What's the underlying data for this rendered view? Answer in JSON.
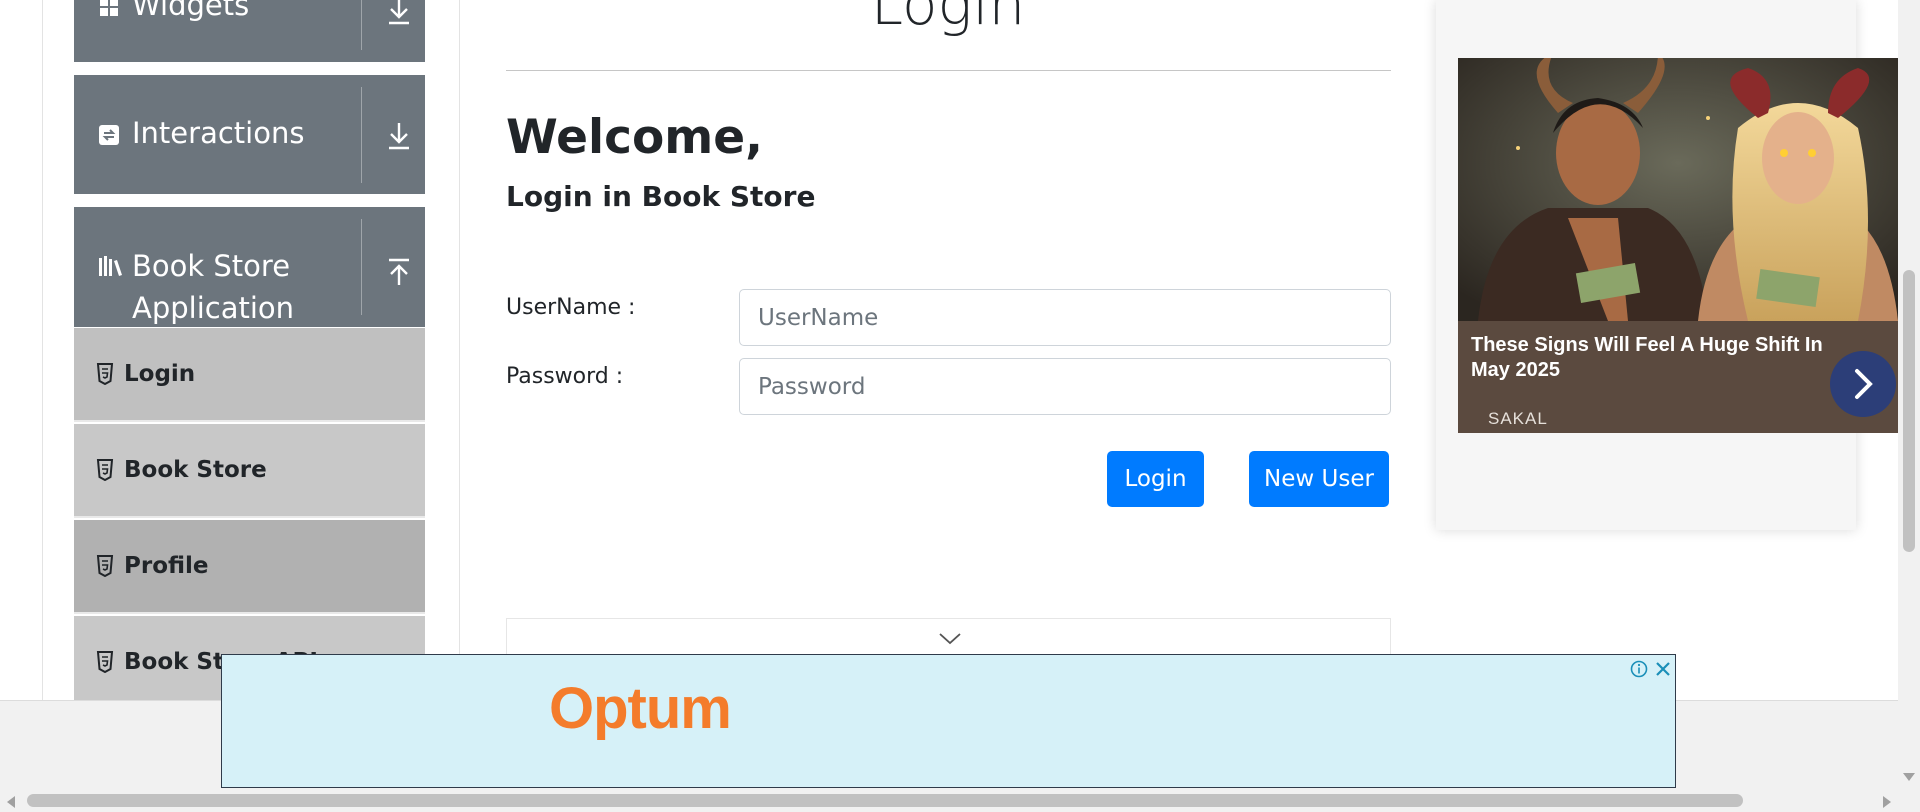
{
  "sidebar": {
    "groups": [
      {
        "label": "Widgets",
        "icon": "widgets-icon",
        "arrow": "arrow-down-icon"
      },
      {
        "label": "Interactions",
        "icon": "interactions-icon",
        "arrow": "arrow-down-icon"
      },
      {
        "label_line1": "Book Store",
        "label_line2": "Application",
        "icon": "books-icon",
        "arrow": "arrow-up-icon"
      }
    ],
    "items": [
      {
        "label": "Login",
        "bg": "#c0c0c0"
      },
      {
        "label": "Book Store",
        "bg": "#c8c8c8"
      },
      {
        "label": "Profile",
        "bg": "#b1b1b1"
      },
      {
        "label": "Book Store API",
        "bg": "#c8c8c8"
      }
    ]
  },
  "main": {
    "title": "Login",
    "welcome": "Welcome,",
    "subheading": "Login in Book Store",
    "username_label": "UserName :",
    "username_placeholder": "UserName",
    "password_label": "Password :",
    "password_placeholder": "Password",
    "login_button": "Login",
    "new_user_button": "New User"
  },
  "side_ad": {
    "headline": "These Signs Will Feel A Huge Shift In May 2025",
    "source": "SAKAL"
  },
  "bottom_ad": {
    "brand": "Optum"
  },
  "colors": {
    "primary": "#007bff",
    "sidebar_group": "#6c757d",
    "brand_orange": "#f47c2b",
    "ad_bg": "#d6f1f8"
  }
}
